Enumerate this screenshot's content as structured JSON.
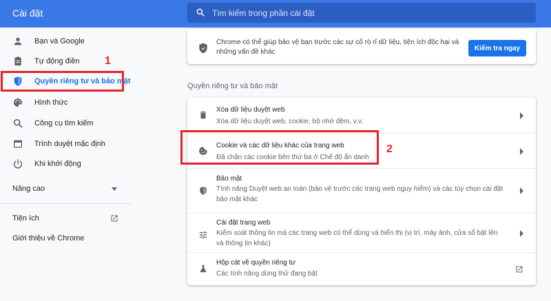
{
  "header": {
    "title": "Cài đặt",
    "search_placeholder": "Tìm kiếm trong phần cài đặt"
  },
  "sidebar": {
    "items": [
      {
        "label": "Bạn và Google",
        "icon": "person-icon"
      },
      {
        "label": "Tự động điền",
        "icon": "clipboard-icon"
      },
      {
        "label": "Quyền riêng tư và bảo mật",
        "icon": "shield-icon",
        "active": true
      },
      {
        "label": "Hình thức",
        "icon": "palette-icon"
      },
      {
        "label": "Công cụ tìm kiếm",
        "icon": "search-icon"
      },
      {
        "label": "Trình duyệt mặc định",
        "icon": "browser-icon"
      },
      {
        "label": "Khi khởi động",
        "icon": "power-icon"
      }
    ],
    "advanced": "Nâng cao",
    "extensions": "Tiện ích",
    "about": "Giới thiệu về Chrome"
  },
  "annotations": {
    "one": "1",
    "two": "2"
  },
  "safety_check": {
    "text": "Chrome có thể giúp bảo vệ bạn trước các sự cố rò rỉ dữ liệu, tiện ích độc hại và những vấn đề khác",
    "button": "Kiểm tra ngay"
  },
  "privacy": {
    "section_title": "Quyền riêng tư và bảo mật",
    "rows": [
      {
        "title": "Xóa dữ liệu duyệt web",
        "sub": "Xóa dữ liệu duyệt web, cookie, bộ nhớ đệm, v.v.",
        "icon": "trash-icon"
      },
      {
        "title": "Cookie và các dữ liệu khác của trang web",
        "sub": "Đã chặn các cookie bên thứ ba ở Chế độ ẩn danh",
        "icon": "cookie-icon"
      },
      {
        "title": "Bảo mật",
        "sub": "Tính năng Duyệt web an toàn (bảo vệ trước các trang web nguy hiểm) và các tùy chọn cài đặt bảo mật khác",
        "icon": "shield-icon"
      },
      {
        "title": "Cài đặt trang web",
        "sub": "Kiểm soát thông tin mà các trang web có thể dùng và hiển thị (vị trí, máy ảnh, cửa sổ bật lên và thông tin khác)",
        "icon": "tune-icon"
      },
      {
        "title": "Hộp cát về quyền riêng tư",
        "sub": "Các tính năng dùng thử đang bật",
        "icon": "flask-icon"
      }
    ]
  },
  "colors": {
    "accent": "#1a73e8",
    "header": "#3b78e7",
    "annotation": "#e5222a"
  }
}
